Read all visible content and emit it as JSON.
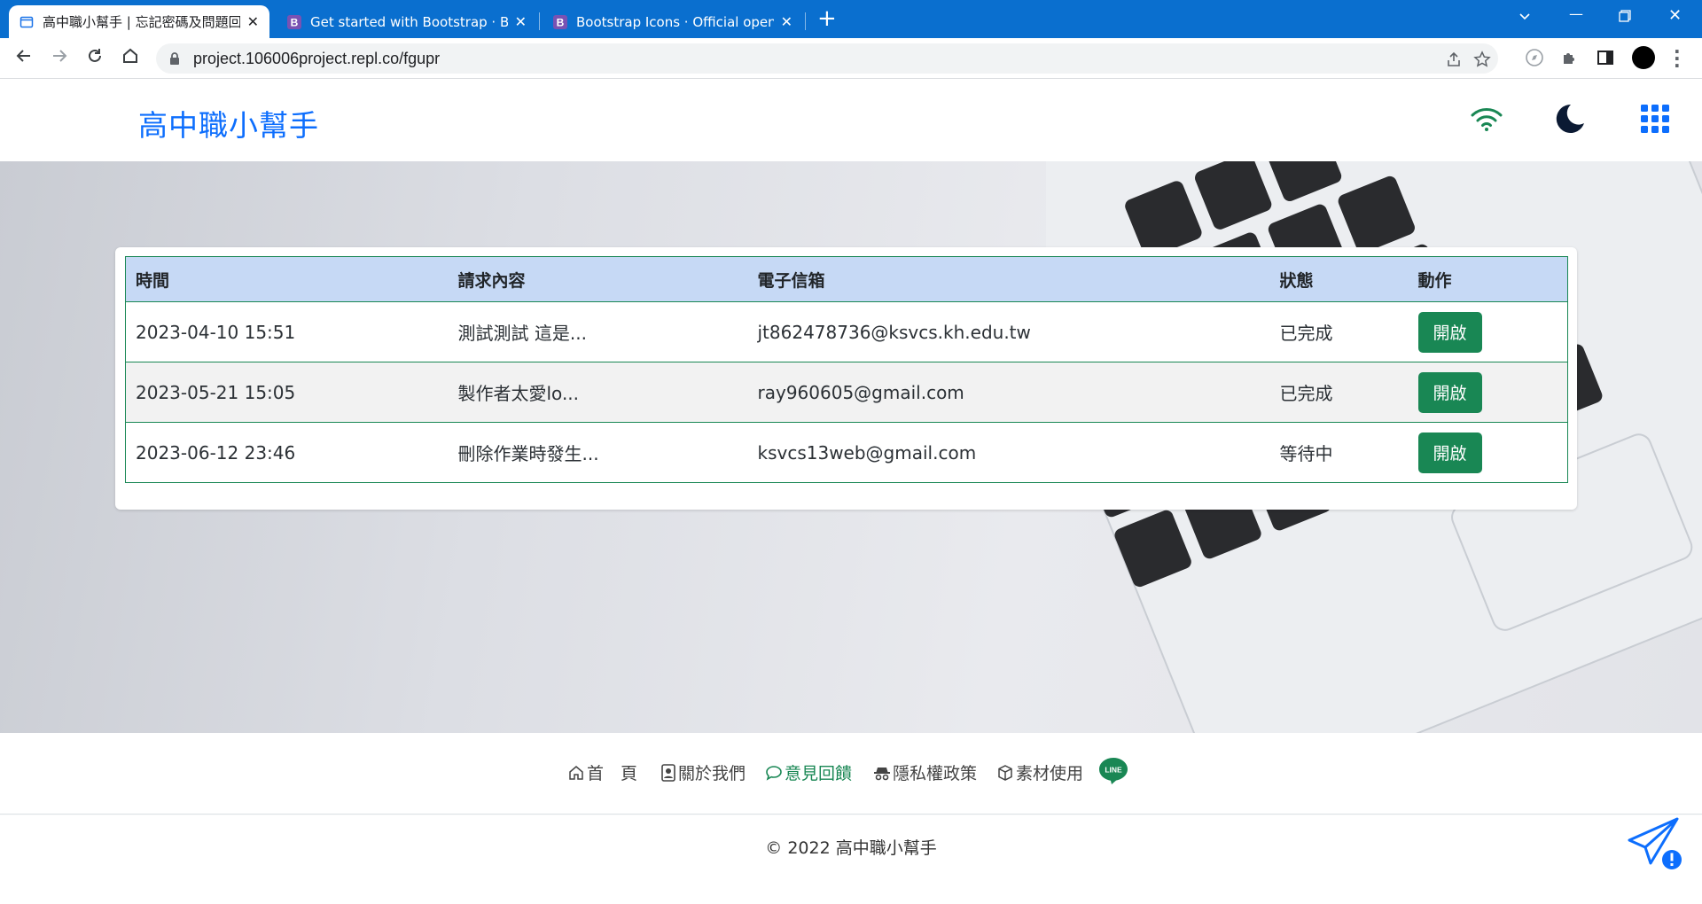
{
  "browser": {
    "tabs": [
      {
        "title": "高中職小幫手 | 忘記密碼及問題回",
        "active": true
      },
      {
        "title": "Get started with Bootstrap · Bo",
        "active": false
      },
      {
        "title": "Bootstrap Icons · Official open",
        "active": false
      }
    ],
    "url": "project.106006project.repl.co/fgupr"
  },
  "navbar": {
    "brand": "高中職小幫手",
    "icons": [
      "wifi-icon",
      "moon-icon",
      "grid-icon"
    ]
  },
  "table": {
    "headers": [
      "時間",
      "請求內容",
      "電子信箱",
      "狀態",
      "動作"
    ],
    "rows": [
      {
        "time": "2023-04-10 15:51",
        "content": "測試測試 這是...",
        "email": "jt862478736@ksvcs.kh.edu.tw",
        "status": "已完成",
        "action": "開啟"
      },
      {
        "time": "2023-05-21 15:05",
        "content": "製作者太愛lo...",
        "email": "ray960605@gmail.com",
        "status": "已完成",
        "action": "開啟"
      },
      {
        "time": "2023-06-12 23:46",
        "content": "刪除作業時發生...",
        "email": "ksvcs13web@gmail.com",
        "status": "等待中",
        "action": "開啟"
      }
    ]
  },
  "footer": {
    "links": [
      {
        "label": "首　頁",
        "icon": "house-icon"
      },
      {
        "label": "關於我們",
        "icon": "person-badge-icon"
      },
      {
        "label": "意見回饋",
        "icon": "chat-icon"
      },
      {
        "label": "隱私權政策",
        "icon": "incognito-icon"
      },
      {
        "label": "素材使用",
        "icon": "box-icon"
      }
    ],
    "line_label": "LINE",
    "copyright": "© 2022 高中職小幫手"
  },
  "colors": {
    "primary": "#0d6efd",
    "success": "#198754",
    "header_bg": "#c6d9f5",
    "tabbar": "#0a6fcf"
  }
}
